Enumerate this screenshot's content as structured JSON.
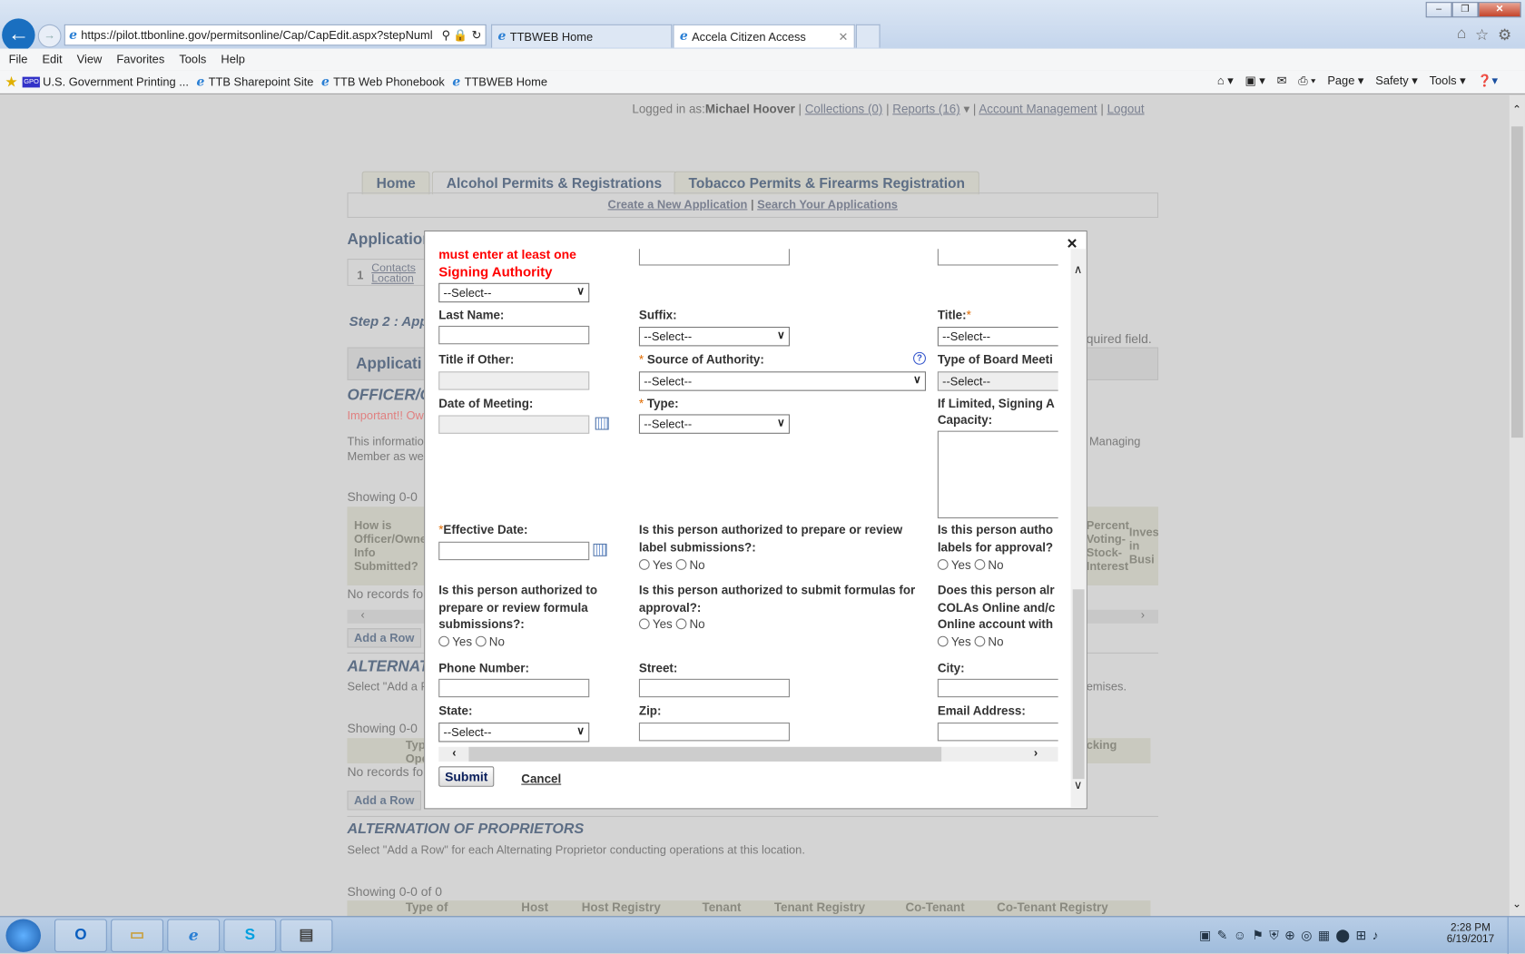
{
  "browser": {
    "address": "https://pilot.ttbonline.gov/permitsonline/Cap/CapEdit.aspx?stepNuml",
    "tabs": [
      {
        "label": "TTBWEB Home"
      },
      {
        "label": "Accela Citizen Access",
        "active": true
      }
    ],
    "menu": [
      "File",
      "Edit",
      "View",
      "Favorites",
      "Tools",
      "Help"
    ],
    "favorites": [
      "U.S. Government Printing ...",
      "TTB Sharepoint Site",
      "TTB Web Phonebook",
      "TTBWEB Home"
    ],
    "favorites_gpo_logo": "GPO",
    "commands": [
      "Page",
      "Safety",
      "Tools"
    ],
    "window_controls": [
      "minimize-icon",
      "restore-icon",
      "close-icon"
    ]
  },
  "header": {
    "logged_in_label": "Logged in as:",
    "user": "Michael Hoover",
    "collections": "Collections (0)",
    "reports": "Reports (16)",
    "account": "Account Management",
    "logout": "Logout"
  },
  "nav": {
    "tabs": [
      "Home",
      "Alcohol Permits & Registrations",
      "Tobacco Permits & Firearms Registration"
    ],
    "create": "Create a New Application",
    "search": "Search Your Applications"
  },
  "page": {
    "application_heading": "Application",
    "step_num": "1",
    "step_link1": "Contacts",
    "step_link2": "Location",
    "step2": "Step 2 : App",
    "required_note": "quired field.",
    "app_bar": "Applicati",
    "officer_heading": "OFFICER/O",
    "important": "Important!! Ow",
    "info_line1": "This informatio",
    "info_line2": "Member as we",
    "managing": "Managing",
    "showing1": "Showing 0-0",
    "table1_col1": "How is Officer/Owner Info Submitted?",
    "table1_col_pct": "Percent Voting-Stock-Interest",
    "table1_col_inv": "Inves in Busi",
    "no_records": "No records fo",
    "add_row": "Add a Row",
    "alt_heading": "ALTERNAT",
    "alt_select": "Select \"Add a R",
    "premises": "emises.",
    "showing2": "Showing 0-0",
    "table2_col1": "Typ Ope",
    "table2_col2": "cking",
    "alt_prop_heading": "ALTERNATION OF PROPRIETORS",
    "alt_prop_text": "Select \"Add a Row\" for each Alternating Proprietor conducting operations at this location.",
    "showing3": "Showing 0-0 of 0",
    "table3_cols": [
      "Type of",
      "Host",
      "Host Registry",
      "Tenant",
      "Tenant Registry",
      "Co-Tenant",
      "Co-Tenant Registry"
    ]
  },
  "modal": {
    "close": "×",
    "error_line1": "must enter at least one",
    "error_line2": "Signing Authority",
    "select_placeholder": "--Select--",
    "last_name": "Last Name:",
    "suffix": "Suffix:",
    "title": "Title:",
    "title_other": "Title if Other:",
    "source_authority": "Source of Authority:",
    "board_meeting": "Type of Board Meeti",
    "date_meeting": "Date of Meeting:",
    "type": "Type:",
    "limited1": "If Limited, Signing A",
    "limited2": "Capacity:",
    "effective_date": "Effective Date:",
    "q_label1": "Is this person authorized to prepare or review",
    "q_label2": "label submissions?:",
    "q_approve1": "Is this person autho",
    "q_approve2": "labels for approval?",
    "q_formula1": "Is this person authorized to",
    "q_formula2": "prepare or review formula",
    "q_formula3": "submissions?:",
    "q_submit1": "Is this person authorized to submit formulas for",
    "q_submit2": "approval?:",
    "q_colas1": "Does this person alr",
    "q_colas2": "COLAs Online and/c",
    "q_colas3": "Online account with",
    "yes": "Yes",
    "no": "No",
    "phone": "Phone Number:",
    "street": "Street:",
    "city": "City:",
    "state": "State:",
    "zip": "Zip:",
    "email": "Email Address:",
    "submit": "Submit",
    "cancel": "Cancel",
    "required_mark": "*",
    "help": "?"
  },
  "taskbar": {
    "time": "2:28 PM",
    "date": "6/19/2017"
  },
  "colors": {
    "error": "#ff0000",
    "required": "#e06b00",
    "link": "#1a6fc0",
    "page_heading": "#5d6e85"
  }
}
